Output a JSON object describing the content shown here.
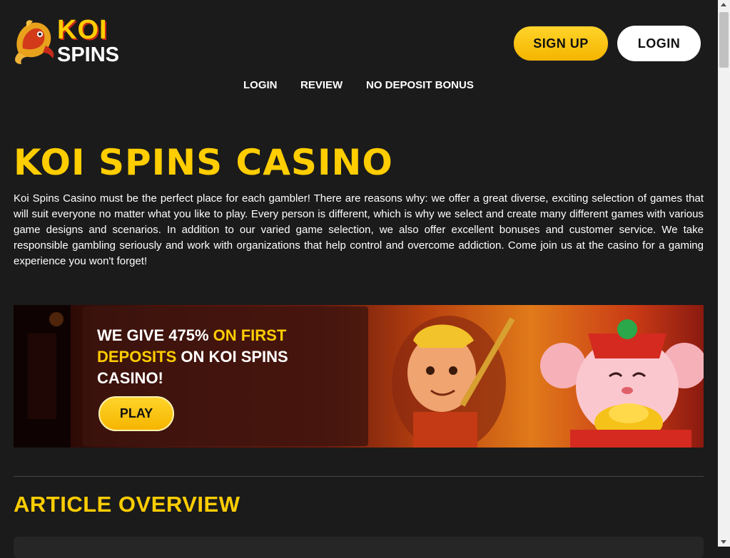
{
  "header": {
    "logo_line1": "KOI",
    "logo_line2": "SPINS",
    "signup_label": "SIGN UP",
    "login_label": "LOGIN"
  },
  "nav": {
    "items": [
      {
        "label": "LOGIN"
      },
      {
        "label": "REVIEW"
      },
      {
        "label": "NO DEPOSIT BONUS"
      }
    ]
  },
  "main": {
    "title": "KOI SPINS CASINO",
    "intro": "Koi Spins Casino must be the perfect place for each gambler! There are reasons why: we offer a great diverse, exciting selection of games that will suit everyone no matter what you like to play. Every person is different, which is why we select and create many different games with various game designs and scenarios. In addition to our varied game selection, we also offer excellent bonuses and customer service. We take responsible gambling seriously and work with organizations that help control and overcome addiction. Come join us at the casino for a gaming experience you won't forget!"
  },
  "banner": {
    "headline_part1": "WE GIVE 475% ",
    "headline_part2": "ON FIRST DEPOSITS",
    "headline_part3": " ON KOI SPINS CASINO!",
    "play_label": "PLAY"
  },
  "overview": {
    "heading": "ARTICLE OVERVIEW"
  },
  "colors": {
    "accent": "#ffcd00",
    "background": "#1b1b1b",
    "button_light": "#ffffff"
  },
  "icons": {
    "logo": "koi-fish-icon"
  }
}
